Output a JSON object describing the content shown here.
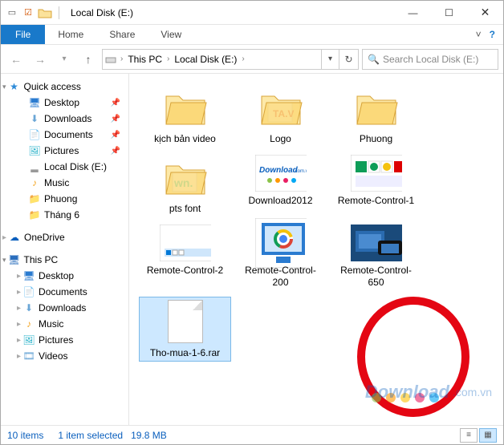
{
  "titlebar": {
    "title": "Local Disk (E:)"
  },
  "ribbon": {
    "file": "File",
    "home": "Home",
    "share": "Share",
    "view": "View"
  },
  "breadcrumb": {
    "root": "This PC",
    "current": "Local Disk (E:)"
  },
  "search": {
    "placeholder": "Search Local Disk (E:)"
  },
  "sidebar": {
    "quick_access": "Quick access",
    "quick_items": [
      {
        "label": "Desktop",
        "icon": "desktop"
      },
      {
        "label": "Downloads",
        "icon": "download"
      },
      {
        "label": "Documents",
        "icon": "document"
      },
      {
        "label": "Pictures",
        "icon": "pictures"
      },
      {
        "label": "Local Disk (E:)",
        "icon": "drive"
      },
      {
        "label": "Music",
        "icon": "music"
      },
      {
        "label": "Phuong",
        "icon": "folder"
      },
      {
        "label": "Tháng 6",
        "icon": "folder"
      }
    ],
    "onedrive": "OneDrive",
    "this_pc": "This PC",
    "pc_items": [
      {
        "label": "Desktop",
        "icon": "desktop"
      },
      {
        "label": "Documents",
        "icon": "document"
      },
      {
        "label": "Downloads",
        "icon": "download"
      },
      {
        "label": "Music",
        "icon": "music"
      },
      {
        "label": "Pictures",
        "icon": "pictures"
      },
      {
        "label": "Videos",
        "icon": "videos"
      }
    ]
  },
  "items": [
    {
      "label": "kịch bản video",
      "kind": "folder"
    },
    {
      "label": "Logo",
      "kind": "folder"
    },
    {
      "label": "Phuong",
      "kind": "folder"
    },
    {
      "label": "pts font",
      "kind": "folder"
    },
    {
      "label": "Download2012",
      "kind": "image-dl"
    },
    {
      "label": "Remote-Control-1",
      "kind": "image-apps"
    },
    {
      "label": "Remote-Control-2",
      "kind": "image-taskbar"
    },
    {
      "label": "Remote-Control-200",
      "kind": "image-chrome"
    },
    {
      "label": "Remote-Control-650",
      "kind": "image-phone"
    },
    {
      "label": "Tho-mua-1-6.rar",
      "kind": "file",
      "selected": true
    }
  ],
  "status": {
    "count": "10 items",
    "selection": "1 item selected",
    "size": "19.8 MB"
  },
  "watermark": {
    "brand": "Download",
    "ext": ".com.vn"
  }
}
